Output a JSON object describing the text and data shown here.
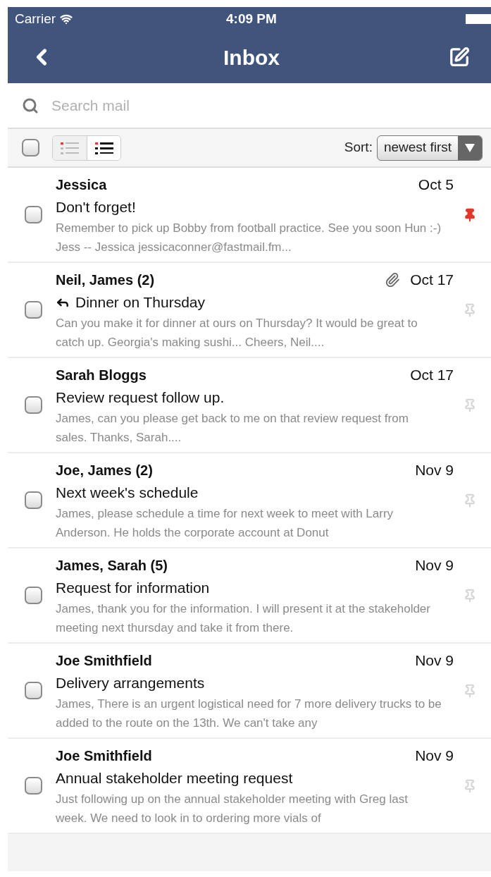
{
  "status_bar": {
    "carrier": "Carrier",
    "time": "4:09 PM"
  },
  "nav": {
    "title": "Inbox"
  },
  "search": {
    "placeholder": "Search mail"
  },
  "toolbar": {
    "select_all": {
      "checked": false
    },
    "views": [
      {
        "kind": "compact",
        "selected": false
      },
      {
        "kind": "detailed",
        "selected": true
      }
    ],
    "sort_label": "Sort:",
    "sort_value": "newest first"
  },
  "messages": [
    {
      "sender": "Jessica",
      "date": "Oct 5",
      "subject": "Don't forget!",
      "preview": "Remember to pick up Bobby from football practice. See you soon Hun :-) Jess -- Jessica jessicaconner@fastmail.fm...",
      "checked": false,
      "pinned": true,
      "attachment": false,
      "replied": false
    },
    {
      "sender": "Neil, James (2)",
      "date": "Oct 17",
      "subject": "Dinner on Thursday",
      "preview": "Can you make it for dinner at ours on Thursday? It would be great to catch up. Georgia's making sushi... Cheers, Neil....",
      "checked": false,
      "pinned": false,
      "attachment": true,
      "replied": true
    },
    {
      "sender": "Sarah Bloggs",
      "date": "Oct 17",
      "subject": "Review request follow up.",
      "preview": "James, can you please get back to me on that review request from sales. Thanks, Sarah....",
      "checked": false,
      "pinned": false,
      "attachment": false,
      "replied": false
    },
    {
      "sender": "Joe, James (2)",
      "date": "Nov 9",
      "subject": "Next week's schedule",
      "preview": "James, please schedule a time for next week to meet with Larry Anderson. He holds the corporate account at Donut",
      "checked": false,
      "pinned": false,
      "attachment": false,
      "replied": false
    },
    {
      "sender": "James, Sarah (5)",
      "date": "Nov 9",
      "subject": "Request for information",
      "preview": "James, thank you for the information. I will present it at the stakeholder meeting next thursday and take it from there.",
      "checked": false,
      "pinned": false,
      "attachment": false,
      "replied": false
    },
    {
      "sender": "Joe Smithfield",
      "date": "Nov 9",
      "subject": "Delivery arrangements",
      "preview": "James, There is an urgent logistical need for 7 more delivery trucks to be added to the route on the 13th. We can't take any",
      "checked": false,
      "pinned": false,
      "attachment": false,
      "replied": false
    },
    {
      "sender": "Joe Smithfield",
      "date": "Nov 9",
      "subject": "Annual stakeholder meeting request",
      "preview": "Just following up on the annual stakeholder meeting with Greg last week. We need to look in to ordering more vials of",
      "checked": false,
      "pinned": false,
      "attachment": false,
      "replied": false
    }
  ]
}
